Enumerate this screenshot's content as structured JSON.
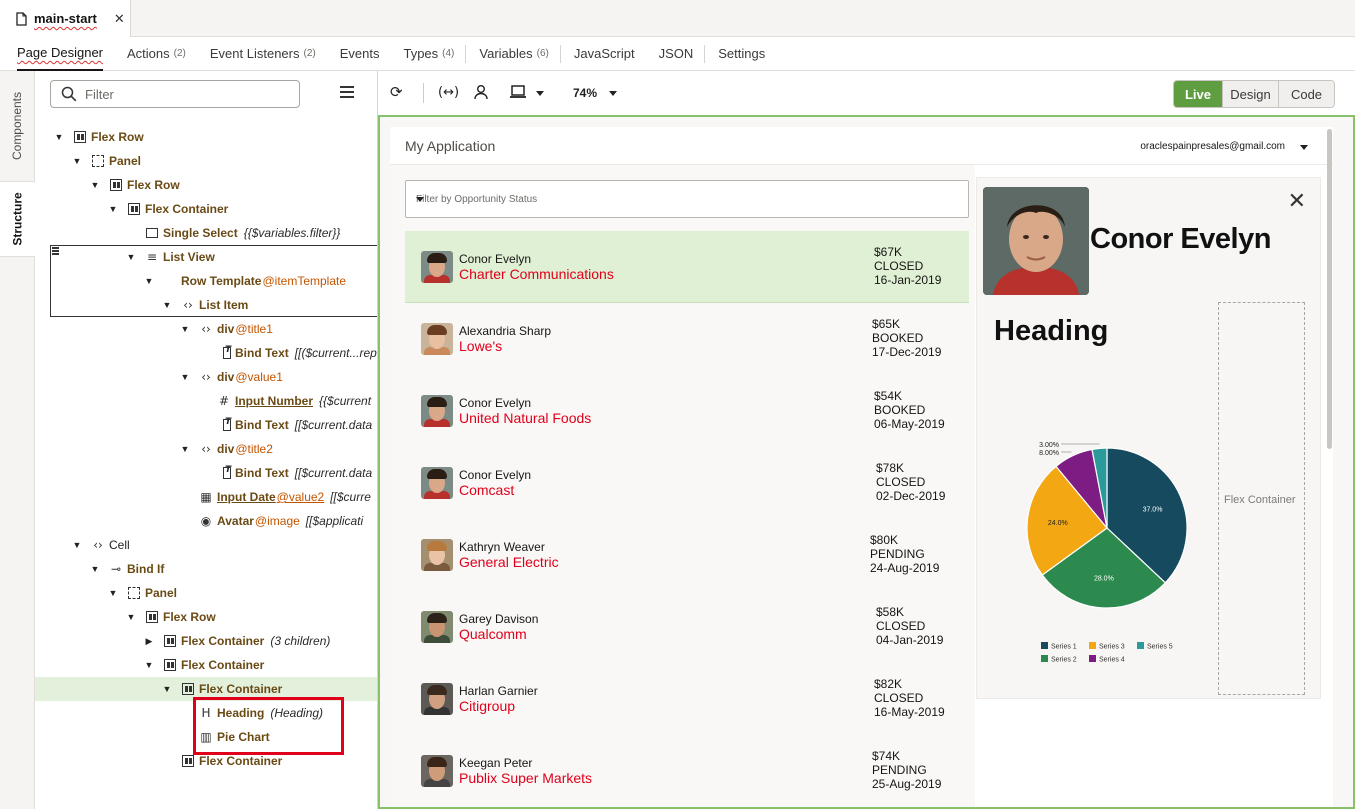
{
  "filetab": {
    "name": "main-start"
  },
  "designer_tabs": [
    {
      "label": "Page Designer",
      "count": ""
    },
    {
      "label": "Actions",
      "count": "(2)"
    },
    {
      "label": "Event Listeners",
      "count": "(2)"
    },
    {
      "label": "Events",
      "count": ""
    },
    {
      "label": "Types",
      "count": "(4)"
    },
    {
      "label": "Variables",
      "count": "(6)"
    },
    {
      "label": "JavaScript",
      "count": ""
    },
    {
      "label": "JSON",
      "count": ""
    },
    {
      "label": "Settings",
      "count": ""
    }
  ],
  "side_tabs": {
    "components": "Components",
    "structure": "Structure"
  },
  "structure": {
    "filter_placeholder": "Filter",
    "tree": [
      {
        "depth": 0,
        "toggle": "down",
        "icon": "flex",
        "name": "Flex Row"
      },
      {
        "depth": 1,
        "toggle": "down",
        "icon": "panel",
        "name": "Panel"
      },
      {
        "depth": 2,
        "toggle": "down",
        "icon": "flex",
        "name": "Flex Row"
      },
      {
        "depth": 3,
        "toggle": "down",
        "icon": "flex",
        "name": "Flex Container"
      },
      {
        "depth": 4,
        "toggle": "",
        "icon": "select",
        "name": "Single Select",
        "bind": "{{$variables.filter}}"
      },
      {
        "depth": 4,
        "toggle": "down",
        "icon": "list",
        "name": "List View"
      },
      {
        "depth": 5,
        "toggle": "down",
        "icon": "row",
        "name": "Row Template",
        "ref": "@itemTemplate"
      },
      {
        "depth": 6,
        "toggle": "down",
        "icon": "code",
        "name": "List Item"
      },
      {
        "depth": 7,
        "toggle": "down",
        "icon": "tag",
        "name": "div",
        "ref": "@title1"
      },
      {
        "depth": 8,
        "toggle": "",
        "icon": "bind",
        "name": "Bind Text",
        "bind": "[[($current...rep"
      },
      {
        "depth": 7,
        "toggle": "down",
        "icon": "tag",
        "name": "div",
        "ref": "@value1"
      },
      {
        "depth": 8,
        "toggle": "",
        "icon": "hash",
        "name": "Input Number",
        "underline": true,
        "bind": "{{$current"
      },
      {
        "depth": 8,
        "toggle": "",
        "icon": "bind",
        "name": "Bind Text",
        "bind": "[[$current.data"
      },
      {
        "depth": 7,
        "toggle": "down",
        "icon": "tag",
        "name": "div",
        "ref": "@title2"
      },
      {
        "depth": 8,
        "toggle": "",
        "icon": "bind",
        "name": "Bind Text",
        "bind": "[[$current.data"
      },
      {
        "depth": 7,
        "toggle": "",
        "icon": "date",
        "name": "Input Date",
        "underline": true,
        "ref": "@value2",
        "bind": "[[$curre"
      },
      {
        "depth": 7,
        "toggle": "",
        "icon": "avatar",
        "name": "Avatar",
        "ref": "@image",
        "bind": "[[$applicati"
      },
      {
        "depth": 1,
        "toggle": "down",
        "icon": "code",
        "name": "Cell",
        "plain": true
      },
      {
        "depth": 2,
        "toggle": "down",
        "icon": "branch",
        "name": "Bind If"
      },
      {
        "depth": 3,
        "toggle": "down",
        "icon": "panel",
        "name": "Panel"
      },
      {
        "depth": 4,
        "toggle": "down",
        "icon": "flex",
        "name": "Flex Row"
      },
      {
        "depth": 5,
        "toggle": "right",
        "icon": "flex",
        "name": "Flex Container",
        "bind": "(3 children)"
      },
      {
        "depth": 5,
        "toggle": "down",
        "icon": "flex",
        "name": "Flex Container"
      },
      {
        "depth": 6,
        "toggle": "down",
        "icon": "flex",
        "name": "Flex Container",
        "selected": true
      },
      {
        "depth": 7,
        "toggle": "",
        "icon": "heading",
        "name": "Heading",
        "bind": "(Heading)"
      },
      {
        "depth": 7,
        "toggle": "",
        "icon": "chart",
        "name": "Pie Chart"
      },
      {
        "depth": 6,
        "toggle": "",
        "icon": "flex",
        "name": "Flex Container"
      }
    ]
  },
  "toolbar": {
    "zoom": "74%",
    "modes": [
      "Live",
      "Design",
      "Code"
    ],
    "active_mode": "Live"
  },
  "app": {
    "title": "My Application",
    "user": "oraclespainpresales@gmail.com",
    "filter_placeholder": "Filter by Opportunity Status",
    "rows": [
      {
        "name": "Conor Evelyn",
        "company": "Charter Communications",
        "amount": "$67K",
        "status": "CLOSED",
        "date": "16-Jan-2019",
        "selected": true,
        "skin": "#d9a889",
        "hair": "#2a1d14",
        "shirt": "#b7322c",
        "bg": "#7d8b87"
      },
      {
        "name": "Alexandria Sharp",
        "company": "Lowe's",
        "amount": "$65K",
        "status": "BOOKED",
        "date": "17-Dec-2019",
        "skin": "#e8bfa0",
        "hair": "#6b3e22",
        "shirt": "#c98a5c",
        "bg": "#c9b39b"
      },
      {
        "name": "Conor Evelyn",
        "company": "United Natural Foods",
        "amount": "$54K",
        "status": "BOOKED",
        "date": "06-May-2019",
        "skin": "#d9a889",
        "hair": "#2a1d14",
        "shirt": "#b7322c",
        "bg": "#7d8b87"
      },
      {
        "name": "Conor Evelyn",
        "company": "Comcast",
        "amount": "$78K",
        "status": "CLOSED",
        "date": "02-Dec-2019",
        "skin": "#d9a889",
        "hair": "#2a1d14",
        "shirt": "#b7322c",
        "bg": "#7d8b87"
      },
      {
        "name": "Kathryn Weaver",
        "company": "General Electric",
        "amount": "$80K",
        "status": "PENDING",
        "date": "24-Aug-2019",
        "skin": "#eac3a6",
        "hair": "#b77a3e",
        "shirt": "#7a5b3e",
        "bg": "#a48f6f"
      },
      {
        "name": "Garey Davison",
        "company": "Qualcomm",
        "amount": "$58K",
        "status": "CLOSED",
        "date": "04-Jan-2019",
        "skin": "#c99472",
        "hair": "#2d221a",
        "shirt": "#3e4c3a",
        "bg": "#7f8a6e"
      },
      {
        "name": "Harlan Garnier",
        "company": "Citigroup",
        "amount": "$82K",
        "status": "CLOSED",
        "date": "16-May-2019",
        "skin": "#d0a080",
        "hair": "#3a2a1e",
        "shirt": "#333333",
        "bg": "#5d5a55"
      },
      {
        "name": "Keegan Peter",
        "company": "Publix Super Markets",
        "amount": "$74K",
        "status": "PENDING",
        "date": "25-Aug-2019",
        "skin": "#cf9c7a",
        "hair": "#3a2618",
        "shirt": "#444444",
        "bg": "#6b6660"
      }
    ],
    "detail": {
      "name": "Conor Evelyn",
      "heading": "Heading",
      "placeholder": "Flex Container"
    }
  },
  "chart_data": {
    "type": "pie",
    "slices": [
      {
        "name": "Series 1",
        "value": 37.0,
        "label": "37.0%",
        "color": "#164a5f"
      },
      {
        "name": "Series 2",
        "value": 28.0,
        "label": "28.0%",
        "color": "#2d8a4e"
      },
      {
        "name": "Series 3",
        "value": 24.0,
        "label": "24.0%",
        "color": "#f3a712"
      },
      {
        "name": "Series 4",
        "value": 8.0,
        "label": "8.00%",
        "color": "#7d1c83"
      },
      {
        "name": "Series 5",
        "value": 3.0,
        "label": "3.00%",
        "color": "#2b9a9b"
      }
    ],
    "legend": "bottom"
  }
}
